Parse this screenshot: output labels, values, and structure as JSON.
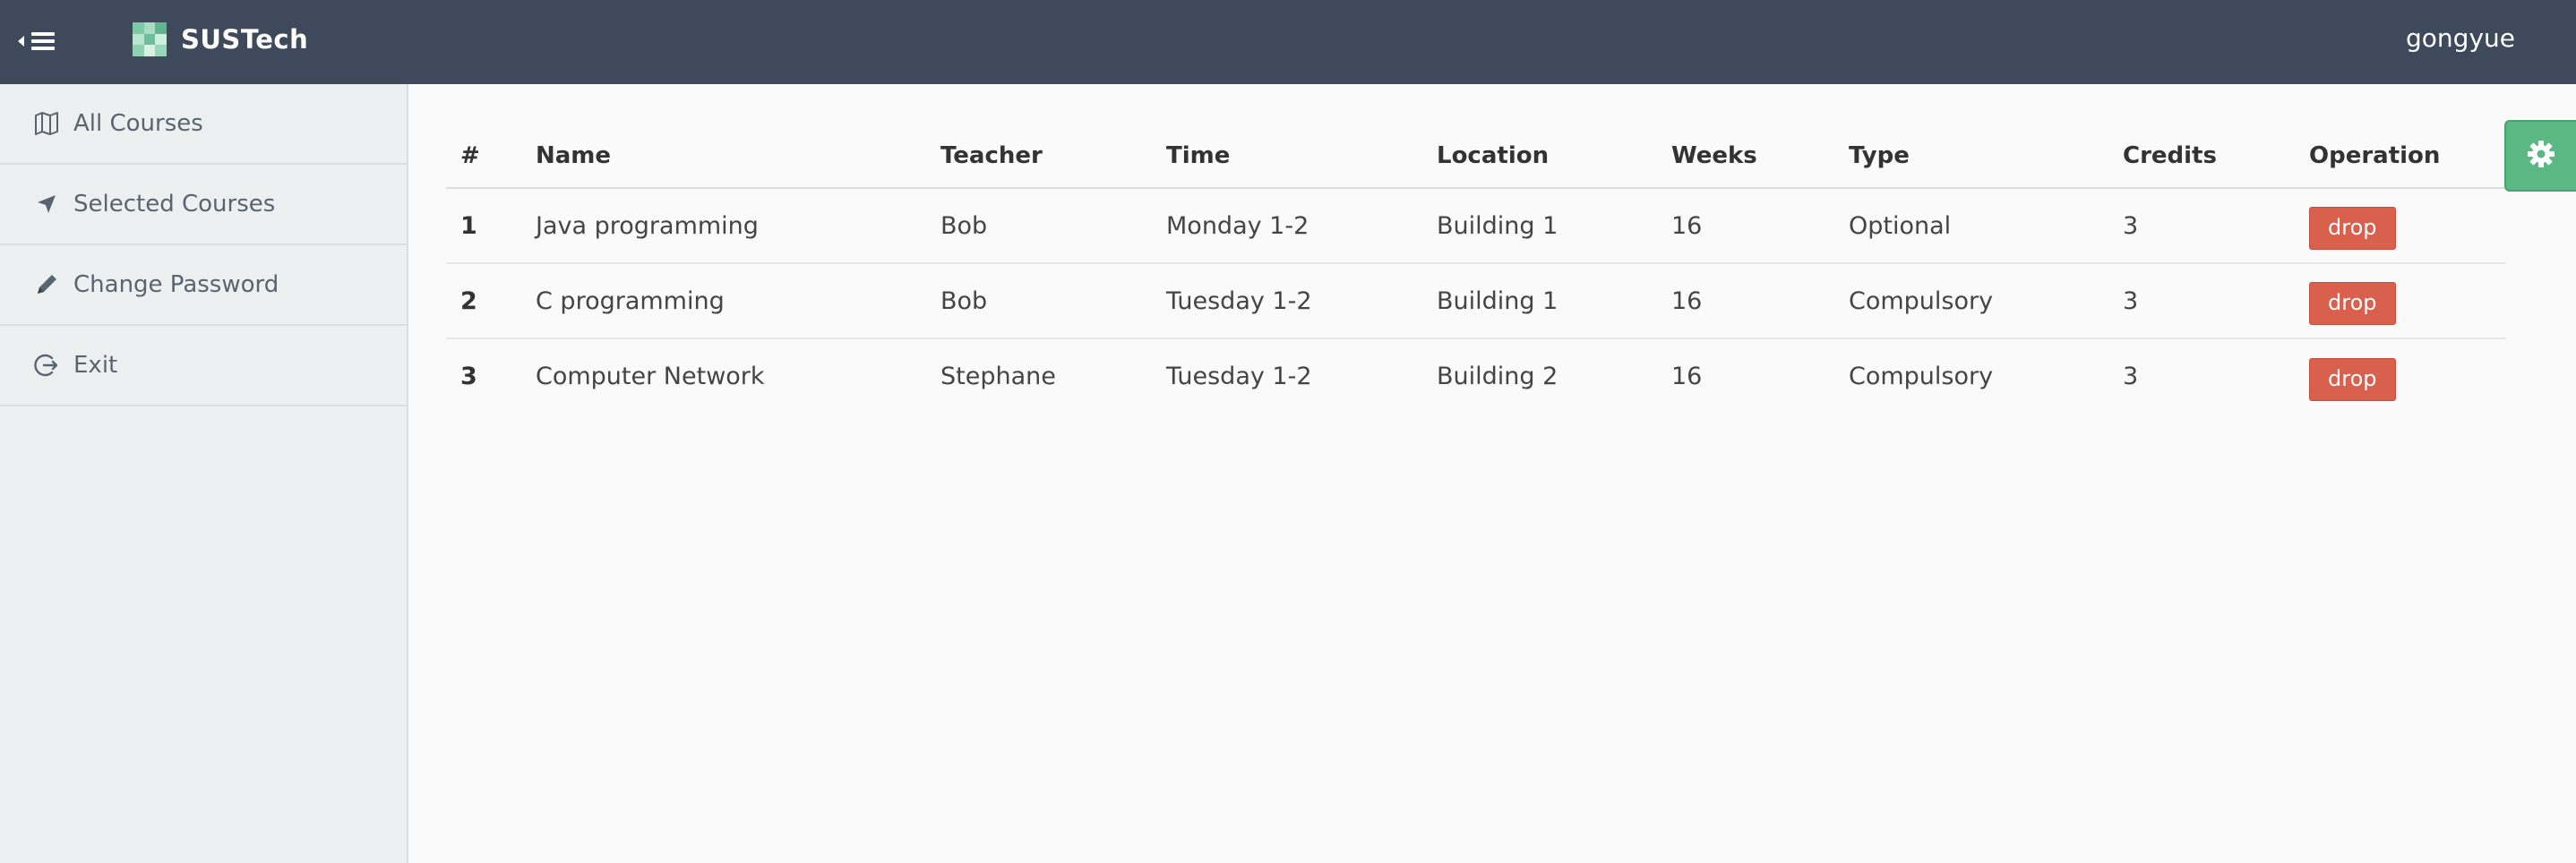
{
  "header": {
    "brand": "SUSTech",
    "user": "gongyue",
    "bg_color": "#3e4a5b"
  },
  "sidebar": {
    "items": [
      {
        "label": "All Courses",
        "icon": "map-icon"
      },
      {
        "label": "Selected Courses",
        "icon": "location-arrow-icon"
      },
      {
        "label": "Change Password",
        "icon": "pencil-icon"
      },
      {
        "label": "Exit",
        "icon": "sign-out-icon"
      }
    ]
  },
  "table": {
    "headers": [
      "#",
      "Name",
      "Teacher",
      "Time",
      "Location",
      "Weeks",
      "Type",
      "Credits",
      "Operation"
    ],
    "rows": [
      {
        "idx": "1",
        "name": "Java programming",
        "teacher": "Bob",
        "time": "Monday 1-2",
        "location": "Building 1",
        "weeks": "16",
        "type": "Optional",
        "credits": "3",
        "op": "drop"
      },
      {
        "idx": "2",
        "name": "C programming",
        "teacher": "Bob",
        "time": "Tuesday 1-2",
        "location": "Building 1",
        "weeks": "16",
        "type": "Compulsory",
        "credits": "3",
        "op": "drop"
      },
      {
        "idx": "3",
        "name": "Computer Network",
        "teacher": "Stephane",
        "time": "Tuesday 1-2",
        "location": "Building 2",
        "weeks": "16",
        "type": "Compulsory",
        "credits": "3",
        "op": "drop"
      }
    ]
  },
  "colors": {
    "accent_green": "#5cb882",
    "danger": "#d9604c"
  }
}
